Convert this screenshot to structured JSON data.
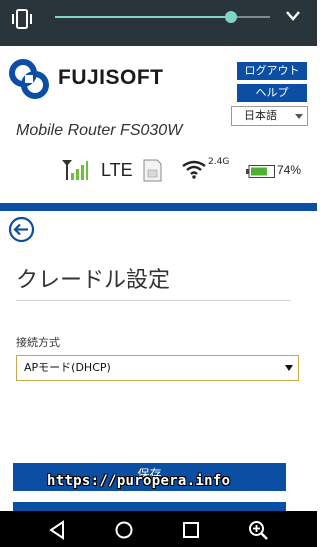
{
  "volume_panel": {
    "level_fraction": 0.82,
    "accent": "#7fd6c6",
    "left_icon": "vibrate-icon",
    "right_icon": "chevron-down-icon"
  },
  "header": {
    "brand": "FUJISOFT",
    "model": "Mobile Router FS030W",
    "logout_label": "ログアウト",
    "help_label": "ヘルプ",
    "language": "日本語",
    "accent": "#0b4fa5"
  },
  "status": {
    "signal_icon": "signal-bars-icon",
    "network": "LTE",
    "sim_icon": "sim-card-icon",
    "wifi_icon": "wifi-icon",
    "wifi_band": "2.4G",
    "battery_icon": "battery-icon",
    "battery": "74%",
    "battery_fraction": 0.74
  },
  "page": {
    "back_icon": "back-arrow-icon",
    "title": "クレードル設定",
    "connection_label": "接続方式",
    "connection_value": "APモード(DHCP)",
    "save_label": "保存"
  },
  "watermark": "https://puropera.info",
  "nav": {
    "back": "nav-back-icon",
    "home": "nav-home-icon",
    "recents": "nav-recents-icon",
    "zoom": "zoom-in-icon"
  }
}
